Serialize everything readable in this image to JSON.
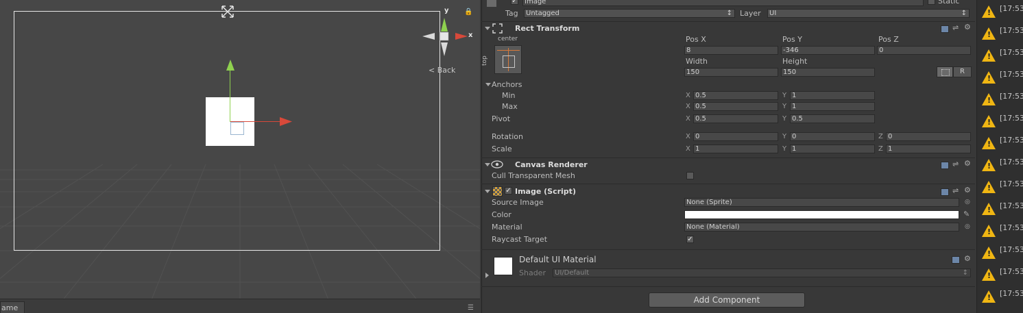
{
  "scene": {
    "back_label": "Back",
    "gizmo_x_label": "x",
    "gizmo_y_label": "y",
    "game_tab_label": "ame"
  },
  "inspector": {
    "object_name": "Image",
    "static_label": "Static",
    "tag_label": "Tag",
    "tag_value": "Untagged",
    "layer_label": "Layer",
    "layer_value": "UI",
    "rect_transform": {
      "title": "Rect Transform",
      "anchor_preset_top": "center",
      "anchor_preset_side": "top",
      "pos_x_label": "Pos X",
      "pos_x": "8",
      "pos_y_label": "Pos Y",
      "pos_y": "-346",
      "pos_z_label": "Pos Z",
      "pos_z": "0",
      "width_label": "Width",
      "width": "150",
      "height_label": "Height",
      "height": "150",
      "raw_button": "R",
      "anchors_label": "Anchors",
      "min_label": "Min",
      "min_x": "0.5",
      "min_y": "1",
      "max_label": "Max",
      "max_x": "0.5",
      "max_y": "1",
      "pivot_label": "Pivot",
      "pivot_x": "0.5",
      "pivot_y": "0.5",
      "rotation_label": "Rotation",
      "rot_x": "0",
      "rot_y": "0",
      "rot_z": "0",
      "scale_label": "Scale",
      "scale_x": "1",
      "scale_y": "1",
      "scale_z": "1",
      "axis_x": "X",
      "axis_y": "Y",
      "axis_z": "Z"
    },
    "canvas_renderer": {
      "title": "Canvas Renderer",
      "cull_label": "Cull Transparent Mesh"
    },
    "image_script": {
      "title": "Image (Script)",
      "source_image_label": "Source Image",
      "source_image": "None (Sprite)",
      "color_label": "Color",
      "color_value": "#ffffff",
      "material_label": "Material",
      "material": "None (Material)",
      "raycast_label": "Raycast Target"
    },
    "material_preview": {
      "title": "Default UI Material",
      "shader_label": "Shader",
      "shader_value": "UI/Default"
    },
    "add_component_label": "Add Component"
  },
  "console": {
    "entries": [
      "[17:53",
      "[17:53",
      "[17:53",
      "[17:53",
      "[17:53",
      "[17:53",
      "[17:53",
      "[17:53",
      "[17:53",
      "[17:53",
      "[17:53",
      "[17:53",
      "[17:53",
      "[17:53"
    ]
  },
  "colors": {
    "scene_bg": "#474747",
    "inspector_bg": "#383838",
    "warning": "#f0b613",
    "gizmo_x": "#d8493a",
    "gizmo_y": "#8fd14f"
  }
}
